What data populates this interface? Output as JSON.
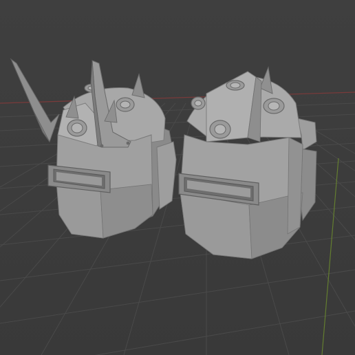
{
  "viewport": {
    "background_color": "#3d3d3d",
    "grid_color": "#4a4a4a",
    "x_axis_color": "#8a3a3a",
    "y_axis_color": "#6b8a2e",
    "mesh_color": "#9c9c9c"
  },
  "objects": [
    {
      "name": "helmet-left",
      "variant": "spiked"
    },
    {
      "name": "helmet-right",
      "variant": "plain"
    }
  ]
}
